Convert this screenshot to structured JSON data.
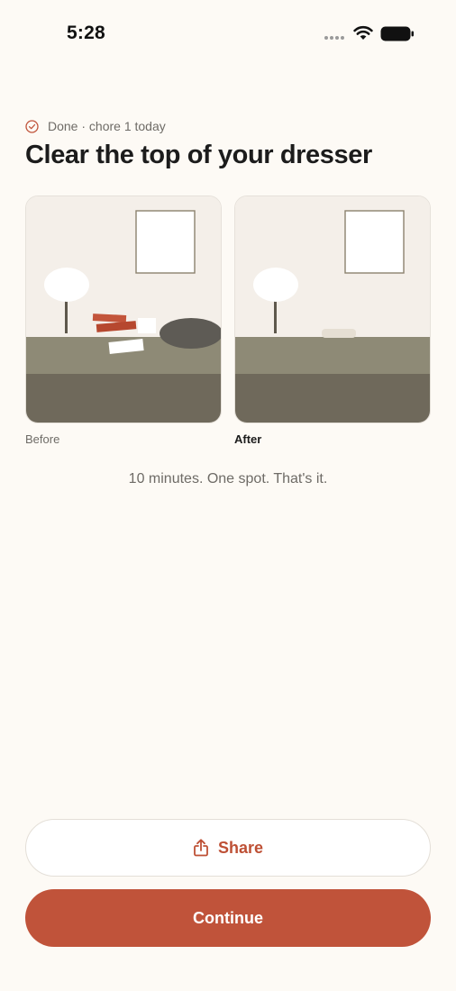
{
  "status_bar": {
    "time": "5:28"
  },
  "header": {
    "done_text": "Done · chore 1 today",
    "title": "Clear the top of your dresser"
  },
  "photos": {
    "before_caption": "Before",
    "after_caption": "After"
  },
  "tagline": "10 minutes. One spot. That's it.",
  "buttons": {
    "share_label": "Share",
    "continue_label": "Continue"
  },
  "icons": {
    "status": [
      "signal-dots-icon",
      "wifi-icon",
      "battery-icon"
    ],
    "done": "check-circle-icon",
    "share": "share-icon"
  },
  "colors": {
    "background": "#FDFAF5",
    "accent": "#C0533A",
    "text_primary": "#1C1C1C",
    "text_secondary": "#6E6B66",
    "dresser_top": "#8E8A76",
    "dresser_front": "#6F695B",
    "wall": "#F4EFE9"
  }
}
